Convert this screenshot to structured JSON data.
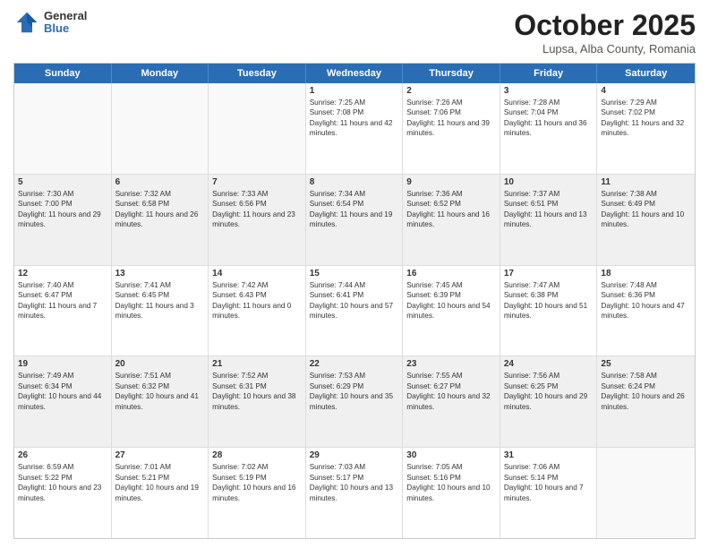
{
  "header": {
    "logo": {
      "general": "General",
      "blue": "Blue"
    },
    "title": "October 2025",
    "subtitle": "Lupsa, Alba County, Romania"
  },
  "days": [
    "Sunday",
    "Monday",
    "Tuesday",
    "Wednesday",
    "Thursday",
    "Friday",
    "Saturday"
  ],
  "weeks": [
    [
      {
        "day": "",
        "empty": true
      },
      {
        "day": "",
        "empty": true
      },
      {
        "day": "",
        "empty": true
      },
      {
        "day": "1",
        "sunrise": "Sunrise: 7:25 AM",
        "sunset": "Sunset: 7:08 PM",
        "daylight": "Daylight: 11 hours and 42 minutes."
      },
      {
        "day": "2",
        "sunrise": "Sunrise: 7:26 AM",
        "sunset": "Sunset: 7:06 PM",
        "daylight": "Daylight: 11 hours and 39 minutes."
      },
      {
        "day": "3",
        "sunrise": "Sunrise: 7:28 AM",
        "sunset": "Sunset: 7:04 PM",
        "daylight": "Daylight: 11 hours and 36 minutes."
      },
      {
        "day": "4",
        "sunrise": "Sunrise: 7:29 AM",
        "sunset": "Sunset: 7:02 PM",
        "daylight": "Daylight: 11 hours and 32 minutes."
      }
    ],
    [
      {
        "day": "5",
        "sunrise": "Sunrise: 7:30 AM",
        "sunset": "Sunset: 7:00 PM",
        "daylight": "Daylight: 11 hours and 29 minutes."
      },
      {
        "day": "6",
        "sunrise": "Sunrise: 7:32 AM",
        "sunset": "Sunset: 6:58 PM",
        "daylight": "Daylight: 11 hours and 26 minutes."
      },
      {
        "day": "7",
        "sunrise": "Sunrise: 7:33 AM",
        "sunset": "Sunset: 6:56 PM",
        "daylight": "Daylight: 11 hours and 23 minutes."
      },
      {
        "day": "8",
        "sunrise": "Sunrise: 7:34 AM",
        "sunset": "Sunset: 6:54 PM",
        "daylight": "Daylight: 11 hours and 19 minutes."
      },
      {
        "day": "9",
        "sunrise": "Sunrise: 7:36 AM",
        "sunset": "Sunset: 6:52 PM",
        "daylight": "Daylight: 11 hours and 16 minutes."
      },
      {
        "day": "10",
        "sunrise": "Sunrise: 7:37 AM",
        "sunset": "Sunset: 6:51 PM",
        "daylight": "Daylight: 11 hours and 13 minutes."
      },
      {
        "day": "11",
        "sunrise": "Sunrise: 7:38 AM",
        "sunset": "Sunset: 6:49 PM",
        "daylight": "Daylight: 11 hours and 10 minutes."
      }
    ],
    [
      {
        "day": "12",
        "sunrise": "Sunrise: 7:40 AM",
        "sunset": "Sunset: 6:47 PM",
        "daylight": "Daylight: 11 hours and 7 minutes."
      },
      {
        "day": "13",
        "sunrise": "Sunrise: 7:41 AM",
        "sunset": "Sunset: 6:45 PM",
        "daylight": "Daylight: 11 hours and 3 minutes."
      },
      {
        "day": "14",
        "sunrise": "Sunrise: 7:42 AM",
        "sunset": "Sunset: 6:43 PM",
        "daylight": "Daylight: 11 hours and 0 minutes."
      },
      {
        "day": "15",
        "sunrise": "Sunrise: 7:44 AM",
        "sunset": "Sunset: 6:41 PM",
        "daylight": "Daylight: 10 hours and 57 minutes."
      },
      {
        "day": "16",
        "sunrise": "Sunrise: 7:45 AM",
        "sunset": "Sunset: 6:39 PM",
        "daylight": "Daylight: 10 hours and 54 minutes."
      },
      {
        "day": "17",
        "sunrise": "Sunrise: 7:47 AM",
        "sunset": "Sunset: 6:38 PM",
        "daylight": "Daylight: 10 hours and 51 minutes."
      },
      {
        "day": "18",
        "sunrise": "Sunrise: 7:48 AM",
        "sunset": "Sunset: 6:36 PM",
        "daylight": "Daylight: 10 hours and 47 minutes."
      }
    ],
    [
      {
        "day": "19",
        "sunrise": "Sunrise: 7:49 AM",
        "sunset": "Sunset: 6:34 PM",
        "daylight": "Daylight: 10 hours and 44 minutes."
      },
      {
        "day": "20",
        "sunrise": "Sunrise: 7:51 AM",
        "sunset": "Sunset: 6:32 PM",
        "daylight": "Daylight: 10 hours and 41 minutes."
      },
      {
        "day": "21",
        "sunrise": "Sunrise: 7:52 AM",
        "sunset": "Sunset: 6:31 PM",
        "daylight": "Daylight: 10 hours and 38 minutes."
      },
      {
        "day": "22",
        "sunrise": "Sunrise: 7:53 AM",
        "sunset": "Sunset: 6:29 PM",
        "daylight": "Daylight: 10 hours and 35 minutes."
      },
      {
        "day": "23",
        "sunrise": "Sunrise: 7:55 AM",
        "sunset": "Sunset: 6:27 PM",
        "daylight": "Daylight: 10 hours and 32 minutes."
      },
      {
        "day": "24",
        "sunrise": "Sunrise: 7:56 AM",
        "sunset": "Sunset: 6:25 PM",
        "daylight": "Daylight: 10 hours and 29 minutes."
      },
      {
        "day": "25",
        "sunrise": "Sunrise: 7:58 AM",
        "sunset": "Sunset: 6:24 PM",
        "daylight": "Daylight: 10 hours and 26 minutes."
      }
    ],
    [
      {
        "day": "26",
        "sunrise": "Sunrise: 6:59 AM",
        "sunset": "Sunset: 5:22 PM",
        "daylight": "Daylight: 10 hours and 23 minutes."
      },
      {
        "day": "27",
        "sunrise": "Sunrise: 7:01 AM",
        "sunset": "Sunset: 5:21 PM",
        "daylight": "Daylight: 10 hours and 19 minutes."
      },
      {
        "day": "28",
        "sunrise": "Sunrise: 7:02 AM",
        "sunset": "Sunset: 5:19 PM",
        "daylight": "Daylight: 10 hours and 16 minutes."
      },
      {
        "day": "29",
        "sunrise": "Sunrise: 7:03 AM",
        "sunset": "Sunset: 5:17 PM",
        "daylight": "Daylight: 10 hours and 13 minutes."
      },
      {
        "day": "30",
        "sunrise": "Sunrise: 7:05 AM",
        "sunset": "Sunset: 5:16 PM",
        "daylight": "Daylight: 10 hours and 10 minutes."
      },
      {
        "day": "31",
        "sunrise": "Sunrise: 7:06 AM",
        "sunset": "Sunset: 5:14 PM",
        "daylight": "Daylight: 10 hours and 7 minutes."
      },
      {
        "day": "",
        "empty": true
      }
    ]
  ]
}
